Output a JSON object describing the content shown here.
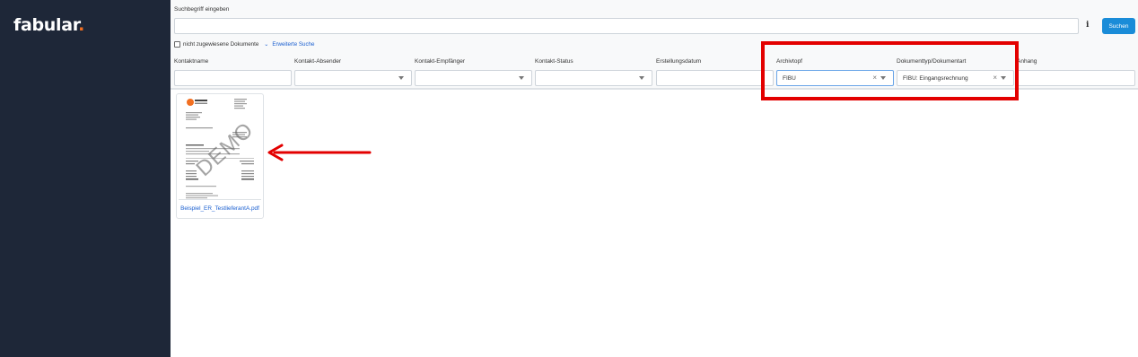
{
  "app": {
    "logo_main": "fabular",
    "logo_dot": "."
  },
  "search": {
    "label": "Suchbegriff eingeben",
    "value": "",
    "button": "Suchen",
    "info_icon": "info-icon"
  },
  "options": {
    "unassigned_label": "nicht zugewiesene Dokumente",
    "advanced_label": "Erweiterte Suche",
    "unassigned_checked": false
  },
  "filters": [
    {
      "label": "Kontaktname",
      "value": ""
    },
    {
      "label": "Kontakt-Absender",
      "value": ""
    },
    {
      "label": "Kontakt-Empfänger",
      "value": ""
    },
    {
      "label": "Kontakt-Status",
      "value": ""
    },
    {
      "label": "Erstellungsdatum",
      "value": ""
    },
    {
      "label": "Archivtopf",
      "value": "FIBU"
    },
    {
      "label": "Dokumenttyp/Dokumentart",
      "value": "FIBU: Eingangsrechnung"
    },
    {
      "label": "Anhang",
      "value": ""
    }
  ],
  "results": [
    {
      "filename": "Beispiel_ER_TestlieferantA.pdf",
      "watermark": "DEMO"
    }
  ],
  "annotation": {
    "highlight_color": "#e30000",
    "arrow_color": "#e30000"
  },
  "colors": {
    "sidebar": "#1e2738",
    "accent": "#1a8cd8",
    "link": "#1a5fd0",
    "logo_dot": "#f26f21"
  }
}
